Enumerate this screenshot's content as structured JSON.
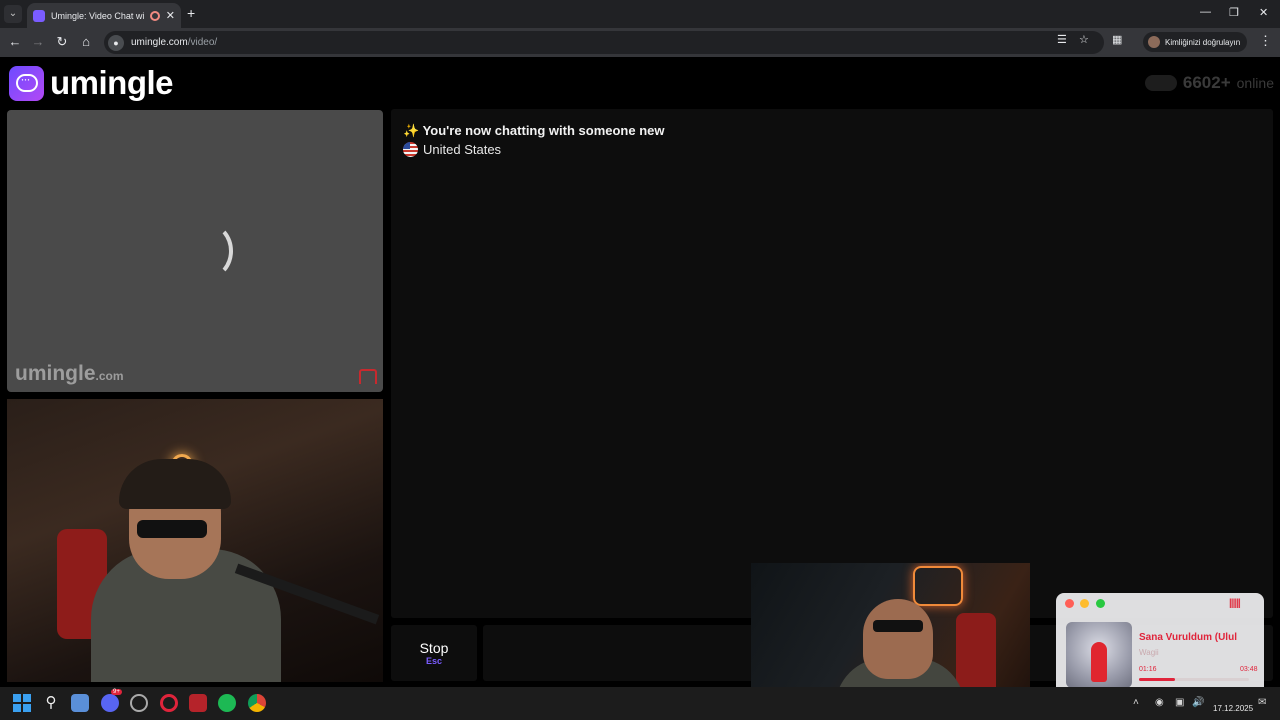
{
  "browser": {
    "tab_title": "Umingle: Video Chat with S",
    "tab_list_icon": "chevron-down-icon",
    "new_tab": "+",
    "url_host": "umingle.com",
    "url_path": "/video/",
    "profile_label": "Kimliğinizi doğrulayın",
    "window_controls": [
      "minimize",
      "restore",
      "close"
    ]
  },
  "header": {
    "logo_text": "umingle",
    "online_count": "6602+",
    "online_label": "online"
  },
  "stranger_video": {
    "watermark": "umingle",
    "watermark_tld": ".com",
    "state": "loading"
  },
  "chat": {
    "status_message": "You're now chatting with someone new",
    "country": "United States",
    "message_value": ""
  },
  "controls": {
    "stop_label": "Stop",
    "stop_hint": "Esc"
  },
  "music_player": {
    "title": "Sana Vuruldum (Ulul",
    "artist": "Wagii",
    "elapsed": "01:16",
    "total": "03:48",
    "progress": 0.33,
    "accent_color": "#e0243b"
  },
  "taskbar": {
    "date": "17.12.2025",
    "discord_badge": "9+",
    "apps": [
      "start-icon",
      "search-icon",
      "app-icon",
      "discord-icon",
      "clock-app-icon",
      "opera-icon",
      "media-icon",
      "spotify-icon",
      "chrome-icon"
    ]
  },
  "colors": {
    "brand": "#7a5cff",
    "panel": "#0d0d0d",
    "report": "#c8292e"
  }
}
